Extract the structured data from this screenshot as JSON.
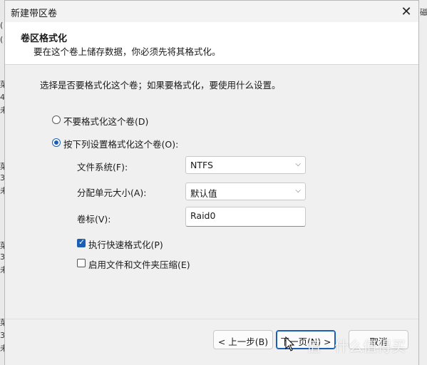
{
  "window": {
    "title": "新建带区卷",
    "close_glyph": "✕"
  },
  "header": {
    "title": "卷区格式化",
    "subtitle": "要在这个卷上储存数据，你必须先将其格式化。"
  },
  "body": {
    "intro": "选择是否要格式化这个卷；如果要格式化，要使用什么设置。",
    "option_no_format": "不要格式化这个卷(D)",
    "option_format": "按下列设置格式化这个卷(O):",
    "filesystem_label": "文件系统(F):",
    "filesystem_value": "NTFS",
    "allocation_label": "分配单元大小(A):",
    "allocation_value": "默认值",
    "volume_label_label": "卷标(V):",
    "volume_label_value": "Raid0",
    "quick_format_label": "执行快速格式化(P)",
    "quick_format_checked": true,
    "compression_label": "启用文件和文件夹压缩(E)",
    "compression_checked": false
  },
  "footer": {
    "back_label": "< 上一步(B)",
    "next_label": "下一页(N) >",
    "cancel_label": "取消"
  },
  "watermark": "值 · 什么值得买",
  "background": {
    "left_chars": [
      "(",
      "(",
      "菜",
      "4",
      "未",
      "菜",
      "3",
      "未",
      "菜",
      "3",
      "未",
      "菜",
      "3",
      "未"
    ],
    "right_char": "磁"
  },
  "colors": {
    "accent": "#1a5fb4"
  }
}
